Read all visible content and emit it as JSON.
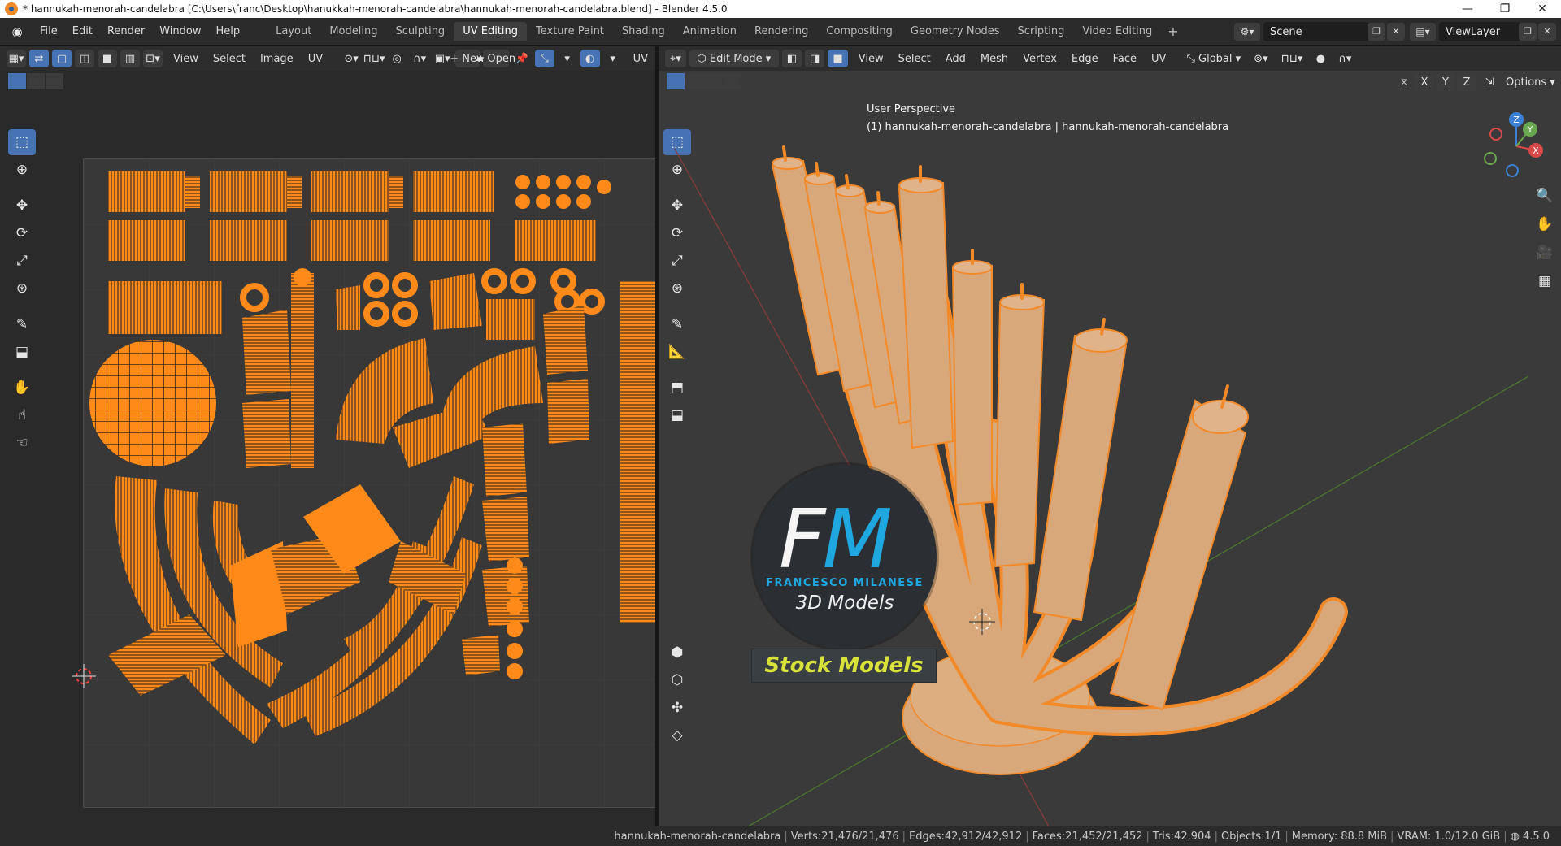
{
  "window": {
    "title": "* hannukah-menorah-candelabra [C:\\Users\\franc\\Desktop\\hanukkah-menorah-candelabra\\hannukah-menorah-candelabra.blend] - Blender 4.5.0",
    "minimize": "—",
    "restore": "❐",
    "close": "✕"
  },
  "menubar": {
    "items": [
      "File",
      "Edit",
      "Render",
      "Window",
      "Help"
    ],
    "workspaces": [
      "Layout",
      "Modeling",
      "Sculpting",
      "UV Editing",
      "Texture Paint",
      "Shading",
      "Animation",
      "Rendering",
      "Compositing",
      "Geometry Nodes",
      "Scripting",
      "Video Editing"
    ],
    "active_workspace": "UV Editing",
    "add_workspace": "+",
    "scene": "Scene",
    "view_layer": "ViewLayer"
  },
  "uv_editor": {
    "menus": [
      "View",
      "Select",
      "Image",
      "UV"
    ],
    "new_label": "New",
    "open_label": "Open",
    "uv_menu": "UV"
  },
  "view3d": {
    "mode": "Edit Mode",
    "menus": [
      "View",
      "Select",
      "Add",
      "Mesh",
      "Vertex",
      "Edge",
      "Face",
      "UV"
    ],
    "orientation": "Global",
    "axes": [
      "X",
      "Y",
      "Z"
    ],
    "options_label": "Options",
    "perspective_label": "User Perspective",
    "object_label": "(1) hannukah-menorah-candelabra | hannukah-menorah-candelabra",
    "gizmo": {
      "z": "Z",
      "y": "Y",
      "x": "X"
    }
  },
  "watermark": {
    "f": "F",
    "m": "M",
    "name": "FRANCESCO MILANESE",
    "sub": "3D Models",
    "banner": "Stock Models"
  },
  "statusbar": {
    "object": "hannukah-menorah-candelabra",
    "verts": "Verts:21,476/21,476",
    "edges": "Edges:42,912/42,912",
    "faces": "Faces:21,452/21,452",
    "tris": "Tris:42,904",
    "objects": "Objects:1/1",
    "memory": "Memory: 88.8 MiB",
    "vram": "VRAM: 1.0/12.0 GiB",
    "version": "4.5.0"
  },
  "colors": {
    "accent": "#4772b3",
    "uv_orange": "#ff8a1a",
    "mesh_orange": "#f28a2a",
    "candle": "#d9a87a"
  }
}
